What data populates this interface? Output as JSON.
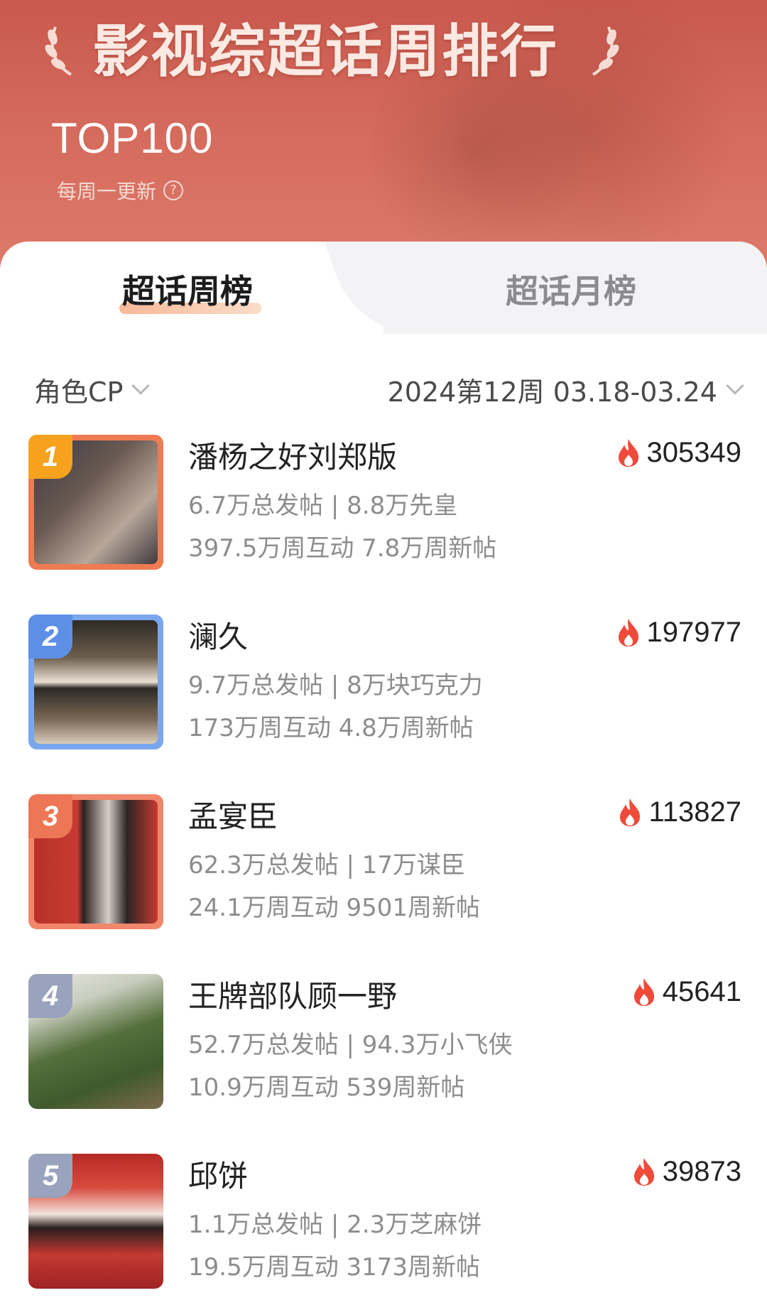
{
  "header": {
    "title": "影视综超话周排行",
    "top_label": "TOP100",
    "update_note": "每周一更新",
    "help_glyph": "?"
  },
  "tabs": [
    {
      "label": "超话周榜",
      "active": true
    },
    {
      "label": "超话月榜",
      "active": false
    }
  ],
  "filters": {
    "category": "角色CP",
    "period": "2024第12周 03.18-03.24"
  },
  "items": [
    {
      "rank": "1",
      "title": "潘杨之好刘郑版",
      "line1": "6.7万总发帖 | 8.8万先皇",
      "line2": "397.5万周互动 7.8万周新帖",
      "heat": "305349",
      "frame_color": "#ef7b52",
      "badge_color": "#f6a21f"
    },
    {
      "rank": "2",
      "title": "澜久",
      "line1": "9.7万总发帖 | 8万块巧克力",
      "line2": "173万周互动 4.8万周新帖",
      "heat": "197977",
      "frame_color": "#7aa6ee",
      "badge_color": "#5e8fe6"
    },
    {
      "rank": "3",
      "title": "孟宴臣",
      "line1": "62.3万总发帖 | 17万谋臣",
      "line2": "24.1万周互动 9501周新帖",
      "heat": "113827",
      "frame_color": "#f1876a",
      "badge_color": "#ec7656"
    },
    {
      "rank": "4",
      "title": "王牌部队顾一野",
      "line1": "52.7万总发帖 | 94.3万小飞侠",
      "line2": "10.9万周互动 539周新帖",
      "heat": "45641",
      "frame_color": "",
      "badge_color": "#9aa3bd"
    },
    {
      "rank": "5",
      "title": "邱饼",
      "line1": "1.1万总发帖 | 2.3万芝麻饼",
      "line2": "19.5万周互动 3173周新帖",
      "heat": "39873",
      "frame_color": "",
      "badge_color": "#9aa3bd"
    }
  ]
}
